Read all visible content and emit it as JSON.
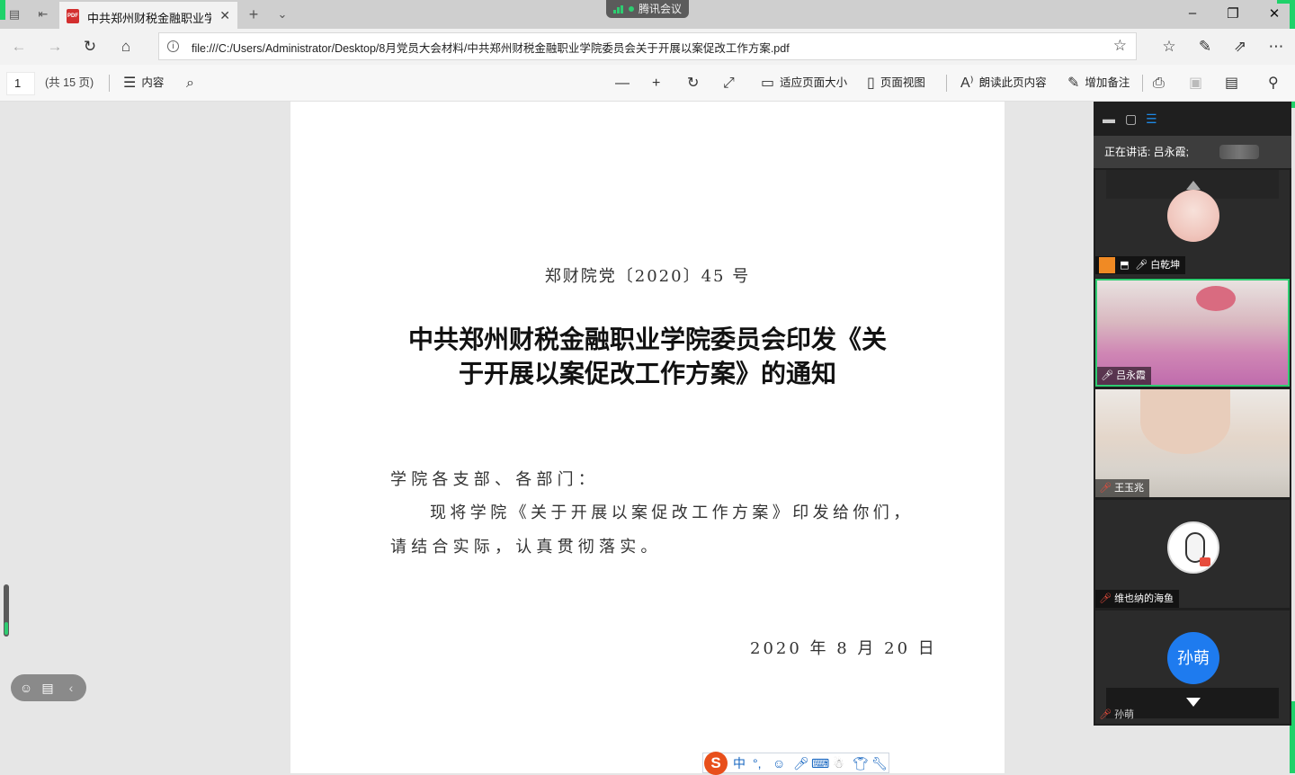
{
  "browser": {
    "tab_title": "中共郑州财税金融职业学",
    "pdf_icon_text": "PDF",
    "url": "file:///C:/Users/Administrator/Desktop/8月党员大会材料/中共郑州财税金融职业学院委员会关于开展以案促改工作方案.pdf",
    "meeting_pill_label": "腾讯会议"
  },
  "pdf_toolbar": {
    "page_number": "1",
    "page_total": "(共 15 页)",
    "contents_label": "内容",
    "fit_page_label": "适应页面大小",
    "page_view_label": "页面视图",
    "read_aloud_label": "朗读此页内容",
    "add_notes_label": "增加备注"
  },
  "document": {
    "doc_number": "郑财院党〔2020〕45 号",
    "title_line1": "中共郑州财税金融职业学院委员会印发《关",
    "title_line2": "于开展以案促改工作方案》的通知",
    "salutation": "学院各支部、各部门：",
    "body_line1": "现将学院《关于开展以案促改工作方案》印发给你们，",
    "body_line2": "请结合实际，认真贯彻落实。",
    "date": "2020 年 8 月 20 日"
  },
  "ime": {
    "lang_label": "中",
    "punct_label": "°,"
  },
  "meeting": {
    "speaking_label": "正在讲话: 吕永霞;",
    "participants": [
      {
        "name": "白乾坤"
      },
      {
        "name": "吕永霞"
      },
      {
        "name": "王玉兆"
      },
      {
        "name": "维也纳的海鱼"
      },
      {
        "name": "孙萌",
        "avatar_text": "孙萌"
      }
    ]
  },
  "colors": {
    "accent_green": "#1fd26a",
    "avatar_blue": "#1e7bef",
    "ime_orange": "#e84f1b"
  }
}
